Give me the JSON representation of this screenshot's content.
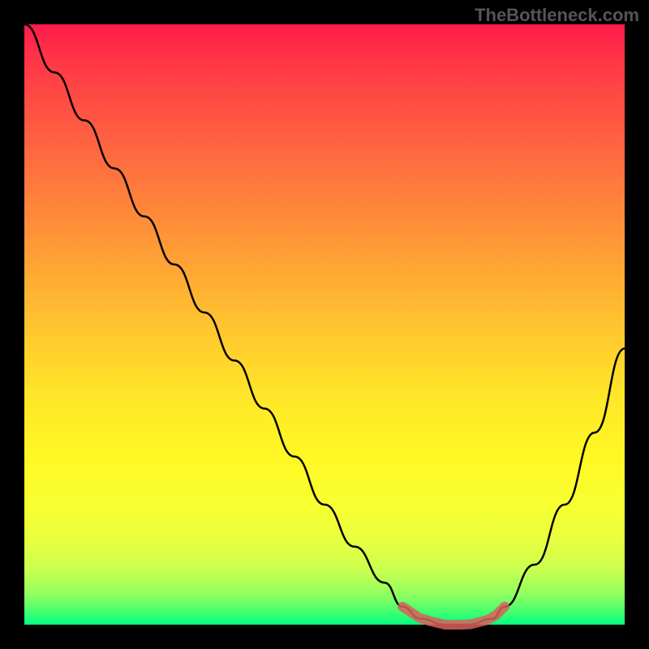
{
  "watermark": "TheBottleneck.com",
  "chart_data": {
    "type": "line",
    "title": "",
    "xlabel": "",
    "ylabel": "",
    "xlim": [
      0,
      100
    ],
    "ylim": [
      0,
      100
    ],
    "x": [
      0,
      5,
      10,
      15,
      20,
      25,
      30,
      35,
      40,
      45,
      50,
      55,
      60,
      63,
      66,
      70,
      74,
      78,
      80,
      85,
      90,
      95,
      100
    ],
    "values": [
      100,
      92,
      84,
      76,
      68,
      60,
      52,
      44,
      36,
      28,
      20,
      13,
      7,
      3,
      1,
      0,
      0,
      1,
      3,
      10,
      20,
      32,
      46
    ],
    "gradient_colors": {
      "top": "#ff1a4a",
      "mid": "#ffe628",
      "bottom": "#00ff80"
    },
    "optimal_range": {
      "x_start": 63,
      "x_end": 80
    }
  }
}
